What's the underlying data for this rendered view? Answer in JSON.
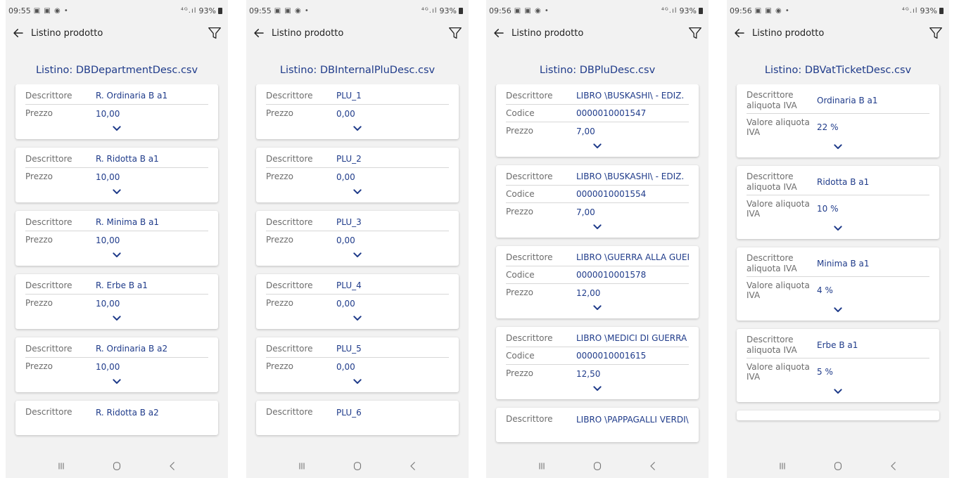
{
  "screens": [
    {
      "status": {
        "time": "09:55",
        "icons": "▣ ▣ ◉ •",
        "signal": "⁴ᴳ.ıl",
        "battery": "93%"
      },
      "app": {
        "title": "Listino prodotto"
      },
      "list_title": "Listino: DBDepartmentDesc.csv",
      "cards": [
        {
          "rows": [
            {
              "label": "Descrittore",
              "value": "R. Ordinaria B a1"
            },
            {
              "label": "Prezzo",
              "value": "10,00"
            }
          ]
        },
        {
          "rows": [
            {
              "label": "Descrittore",
              "value": "R. Ridotta B a1"
            },
            {
              "label": "Prezzo",
              "value": "10,00"
            }
          ]
        },
        {
          "rows": [
            {
              "label": "Descrittore",
              "value": "R. Minima B a1"
            },
            {
              "label": "Prezzo",
              "value": "10,00"
            }
          ]
        },
        {
          "rows": [
            {
              "label": "Descrittore",
              "value": "R. Erbe B a1"
            },
            {
              "label": "Prezzo",
              "value": "10,00"
            }
          ]
        },
        {
          "rows": [
            {
              "label": "Descrittore",
              "value": "R. Ordinaria B a2"
            },
            {
              "label": "Prezzo",
              "value": "10,00"
            }
          ]
        },
        {
          "rows": [
            {
              "label": "Descrittore",
              "value": "R. Ridotta B a2"
            }
          ]
        }
      ]
    },
    {
      "status": {
        "time": "09:55",
        "icons": "▣ ▣ ◉ •",
        "signal": "⁴ᴳ.ıl",
        "battery": "93%"
      },
      "app": {
        "title": "Listino prodotto"
      },
      "list_title": "Listino: DBInternalPluDesc.csv",
      "cards": [
        {
          "rows": [
            {
              "label": "Descrittore",
              "value": "PLU_1"
            },
            {
              "label": "Prezzo",
              "value": "0,00"
            }
          ]
        },
        {
          "rows": [
            {
              "label": "Descrittore",
              "value": "PLU_2"
            },
            {
              "label": "Prezzo",
              "value": "0,00"
            }
          ]
        },
        {
          "rows": [
            {
              "label": "Descrittore",
              "value": "PLU_3"
            },
            {
              "label": "Prezzo",
              "value": "0,00"
            }
          ]
        },
        {
          "rows": [
            {
              "label": "Descrittore",
              "value": "PLU_4"
            },
            {
              "label": "Prezzo",
              "value": "0,00"
            }
          ]
        },
        {
          "rows": [
            {
              "label": "Descrittore",
              "value": "PLU_5"
            },
            {
              "label": "Prezzo",
              "value": "0,00"
            }
          ]
        },
        {
          "rows": [
            {
              "label": "Descrittore",
              "value": "PLU_6"
            }
          ]
        }
      ]
    },
    {
      "status": {
        "time": "09:56",
        "icons": "▣ ▣ ◉ •",
        "signal": "⁴ᴳ.ıl",
        "battery": "93%"
      },
      "app": {
        "title": "Listino prodotto"
      },
      "list_title": "Listino: DBPluDesc.csv",
      "cards": [
        {
          "rows": [
            {
              "label": "Descrittore",
              "value": "LIBRO \\BUSKASHI\\ - EDIZ."
            },
            {
              "label": "Codice",
              "value": "0000010001547"
            },
            {
              "label": "Prezzo",
              "value": "7,00"
            }
          ]
        },
        {
          "rows": [
            {
              "label": "Descrittore",
              "value": "LIBRO \\BUSKASHI\\ - EDIZ."
            },
            {
              "label": "Codice",
              "value": "0000010001554"
            },
            {
              "label": "Prezzo",
              "value": "7,00"
            }
          ]
        },
        {
          "rows": [
            {
              "label": "Descrittore",
              "value": "LIBRO \\GUERRA ALLA GUERR"
            },
            {
              "label": "Codice",
              "value": "0000010001578"
            },
            {
              "label": "Prezzo",
              "value": "12,00"
            }
          ]
        },
        {
          "rows": [
            {
              "label": "Descrittore",
              "value": "LIBRO \\MEDICI DI GUERRA"
            },
            {
              "label": "Codice",
              "value": "0000010001615"
            },
            {
              "label": "Prezzo",
              "value": "12,50"
            }
          ]
        },
        {
          "rows": [
            {
              "label": "Descrittore",
              "value": "LIBRO \\PAPPAGALLI VERDI\\"
            }
          ]
        }
      ]
    },
    {
      "status": {
        "time": "09:56",
        "icons": "▣ ▣ ◉ •",
        "signal": "⁴ᴳ.ıl",
        "battery": "93%"
      },
      "app": {
        "title": "Listino prodotto"
      },
      "list_title": "Listino: DBVatTicketDesc.csv",
      "cards": [
        {
          "rows": [
            {
              "label": "Descrittore aliquota IVA",
              "value": "Ordinaria B a1"
            },
            {
              "label": "Valore aliquota IVA",
              "value": "22 %"
            }
          ]
        },
        {
          "rows": [
            {
              "label": "Descrittore aliquota IVA",
              "value": "Ridotta B a1"
            },
            {
              "label": "Valore aliquota IVA",
              "value": "10 %"
            }
          ]
        },
        {
          "rows": [
            {
              "label": "Descrittore aliquota IVA",
              "value": "Minima B a1"
            },
            {
              "label": "Valore aliquota IVA",
              "value": "4 %"
            }
          ]
        },
        {
          "rows": [
            {
              "label": "Descrittore aliquota IVA",
              "value": "Erbe B a1"
            },
            {
              "label": "Valore aliquota IVA",
              "value": "5 %"
            }
          ]
        },
        {
          "rows": []
        }
      ]
    }
  ],
  "colors": {
    "accent": "#1f3b8a",
    "label": "#6c6c6c",
    "background": "#f2f2f2",
    "card": "#ffffff"
  },
  "icons": {
    "back": "arrow-left-icon",
    "filter": "funnel-icon",
    "expand": "chevron-down-icon",
    "nav_recent": "recent-apps-icon",
    "nav_home": "home-icon",
    "nav_back": "nav-back-icon"
  }
}
